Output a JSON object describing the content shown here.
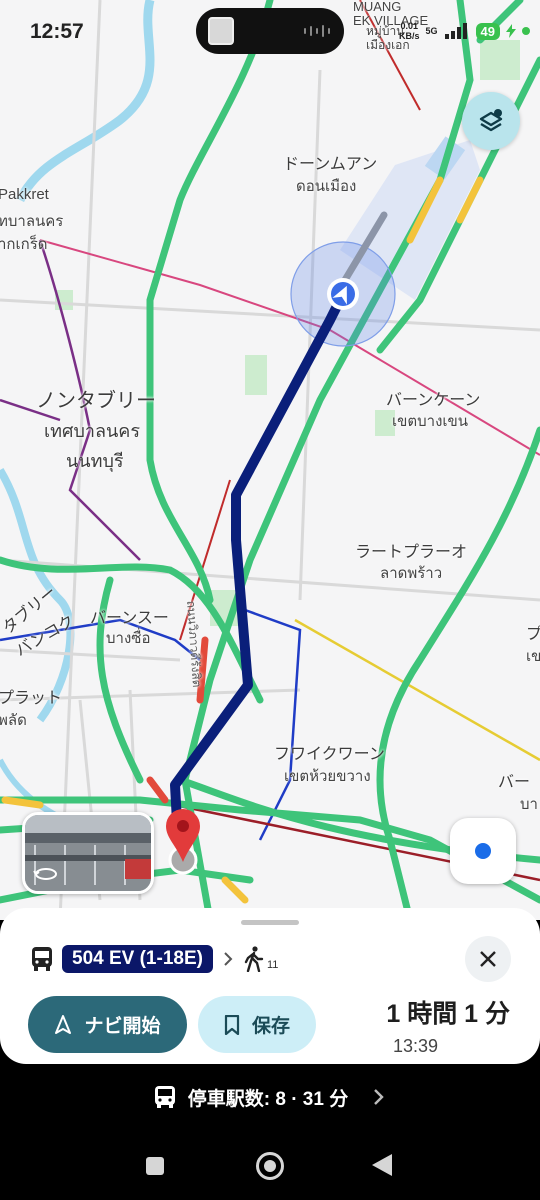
{
  "status_bar": {
    "time": "12:57",
    "network_speed": "0.01\nKB/s",
    "network_type": "5G",
    "battery": "49"
  },
  "map": {
    "labels": [
      {
        "id": "mueang-ek-en",
        "text": "MUANG\nEK VILLAGE"
      },
      {
        "id": "mueang-ek-th",
        "text": "หมู่บ้าน\nเมืองเอก"
      },
      {
        "id": "don-mueang-jp",
        "text": "ドーンムアン"
      },
      {
        "id": "don-mueang-th",
        "text": "ดอนเมือง"
      },
      {
        "id": "pakkret-en",
        "text": "Pakkret"
      },
      {
        "id": "pakkret-th1",
        "text": "ทบาลนคร"
      },
      {
        "id": "pakkret-th2",
        "text": "ากเกร็ด"
      },
      {
        "id": "nonthaburi-jp",
        "text": "ノンタブリー"
      },
      {
        "id": "nonthaburi-th1",
        "text": "เทศบาลนคร"
      },
      {
        "id": "nonthaburi-th2",
        "text": "นนทบุรี"
      },
      {
        "id": "bang-khen-jp",
        "text": "バーンケーン"
      },
      {
        "id": "bang-khen-th",
        "text": "เขตบางเขน"
      },
      {
        "id": "lat-phrao-jp",
        "text": "ラートプラーオ"
      },
      {
        "id": "lat-phrao-th",
        "text": "ลาดพร้าว"
      },
      {
        "id": "bang-sue-jp",
        "text": "バーンスー"
      },
      {
        "id": "bang-sue-th",
        "text": "บางซื่อ"
      },
      {
        "id": "huai-khwang-jp",
        "text": "フワイクワーン"
      },
      {
        "id": "huai-khwang-th",
        "text": "เขตห้วยขวาง"
      },
      {
        "id": "plat-jp",
        "text": "プラット"
      },
      {
        "id": "plat-th",
        "text": "พลัด"
      },
      {
        "id": "bangkok-jp",
        "text": "バンコク"
      },
      {
        "id": "taburi-jp",
        "text": "タブリー"
      },
      {
        "id": "road-name",
        "text": "ถนนวิภาวดีรังสิต"
      },
      {
        "id": "edge-right-1",
        "text": "プ"
      },
      {
        "id": "edge-right-2",
        "text": "เข"
      },
      {
        "id": "edge-right-3",
        "text": "バー"
      },
      {
        "id": "edge-right-4",
        "text": "บา"
      }
    ]
  },
  "controls": {
    "layers_icon": "layers-icon",
    "locate_icon": "my-location-icon"
  },
  "sheet": {
    "route_badge": "504 EV (1-18E)",
    "walk_minutes": "11",
    "navigate_label": "ナビ開始",
    "save_label": "保存",
    "duration": "1 時間 1 分",
    "arrival_time": "13:39"
  },
  "stops_bar": {
    "text": "停車駅数: 8 · 31 分"
  },
  "colors": {
    "route": "#0a1f7a",
    "traffic_green": "#3ec47a",
    "badge_bg": "#0b1768",
    "primary_button": "#2c6979",
    "secondary_button": "#cdeef7"
  }
}
